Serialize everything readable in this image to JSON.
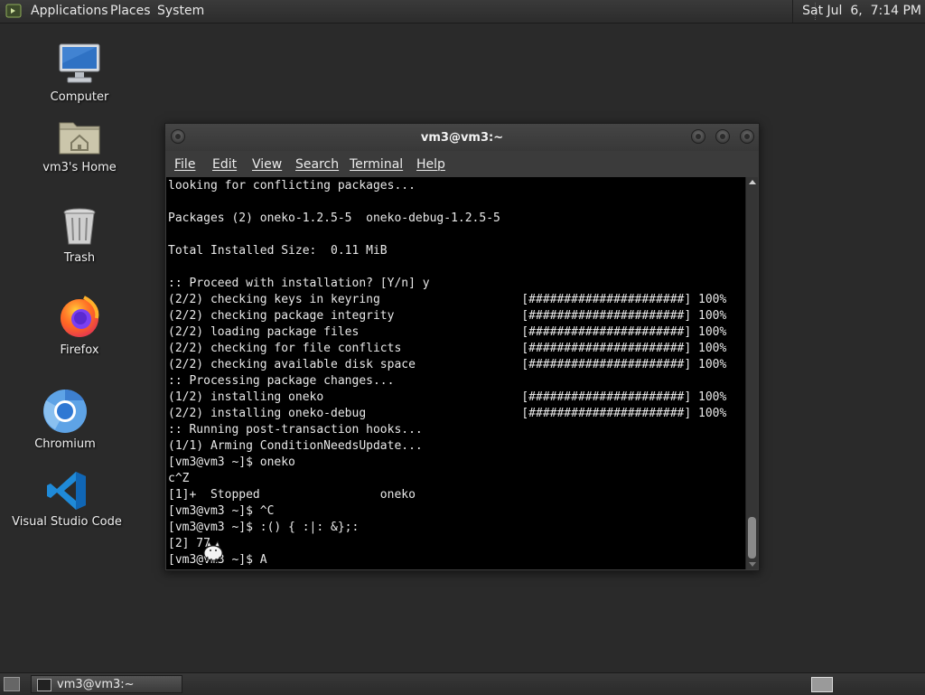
{
  "top_panel": {
    "menus": [
      "Applications",
      "Places",
      "System"
    ],
    "clock": "Sat Jul  6,  7:14 PM"
  },
  "desktop": {
    "icons": [
      {
        "label": "Computer",
        "icon": "computer-icon"
      },
      {
        "label": "vm3's Home",
        "icon": "home-folder-icon"
      },
      {
        "label": "Trash",
        "icon": "trash-icon"
      },
      {
        "label": "Firefox",
        "icon": "firefox-icon"
      },
      {
        "label": "Chromium",
        "icon": "chromium-icon"
      },
      {
        "label": "Visual Studio Code",
        "icon": "vscode-icon"
      }
    ]
  },
  "terminal_window": {
    "title": "vm3@vm3:~",
    "menu": [
      "File",
      "Edit",
      "View",
      "Search",
      "Terminal",
      "Help"
    ],
    "lines": [
      "looking for conflicting packages...",
      "",
      "Packages (2) oneko-1.2.5-5  oneko-debug-1.2.5-5",
      "",
      "Total Installed Size:  0.11 MiB",
      "",
      ":: Proceed with installation? [Y/n] y",
      "(2/2) checking keys in keyring                    [######################] 100%",
      "(2/2) checking package integrity                  [######################] 100%",
      "(2/2) loading package files                       [######################] 100%",
      "(2/2) checking for file conflicts                 [######################] 100%",
      "(2/2) checking available disk space               [######################] 100%",
      ":: Processing package changes...",
      "(1/2) installing oneko                            [######################] 100%",
      "(2/2) installing oneko-debug                      [######################] 100%",
      ":: Running post-transaction hooks...",
      "(1/1) Arming ConditionNeedsUpdate...",
      "[vm3@vm3 ~]$ oneko",
      "c^Z",
      "[1]+  Stopped                 oneko",
      "[vm3@vm3 ~]$ ^C",
      "[vm3@vm3 ~]$ :() { :|: &};:",
      "[2] 77",
      "[vm3@vm3 ~]$ A"
    ]
  },
  "taskbar": {
    "task_label": "vm3@vm3:~"
  }
}
